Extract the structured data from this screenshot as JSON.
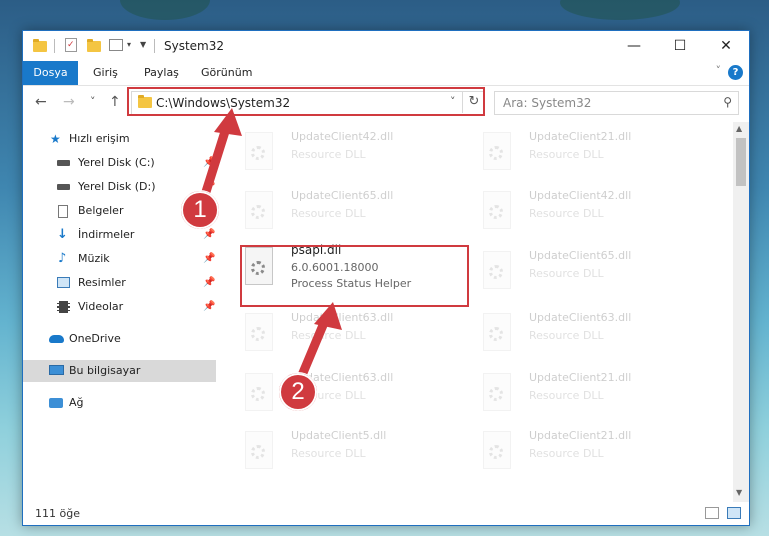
{
  "window": {
    "title": "System32",
    "controls": {
      "minimize": "—",
      "maximize": "☐",
      "close": "✕"
    }
  },
  "ribbon": {
    "tabs": [
      "Dosya",
      "Giriş",
      "Paylaş",
      "Görünüm"
    ],
    "help": "?"
  },
  "nav": {
    "back": "←",
    "forward": "→",
    "recent": "˅",
    "up": "↑",
    "address": "C:\\Windows\\System32",
    "search_placeholder": "Ara: System32"
  },
  "sidebar": {
    "items": [
      {
        "label": "Hızlı erişim",
        "icon": "star-icon",
        "pinned": false
      },
      {
        "label": "Yerel Disk (C:)",
        "icon": "drive-icon",
        "pinned": true
      },
      {
        "label": "Yerel Disk (D:)",
        "icon": "drive-icon",
        "pinned": true
      },
      {
        "label": "Belgeler",
        "icon": "documents-icon",
        "pinned": true
      },
      {
        "label": "İndirmeler",
        "icon": "downloads-icon",
        "pinned": true
      },
      {
        "label": "Müzik",
        "icon": "music-icon",
        "pinned": true
      },
      {
        "label": "Resimler",
        "icon": "pictures-icon",
        "pinned": true
      },
      {
        "label": "Videolar",
        "icon": "videos-icon",
        "pinned": true
      },
      {
        "label": "OneDrive",
        "icon": "cloud-icon",
        "pinned": false
      },
      {
        "label": "Bu bilgisayar",
        "icon": "computer-icon",
        "pinned": false,
        "selected": true
      },
      {
        "label": "Ağ",
        "icon": "network-icon",
        "pinned": false
      }
    ]
  },
  "files": {
    "left": [
      {
        "name": "UpdateClient42.dll",
        "desc": "Resource DLL"
      },
      {
        "name": "UpdateClient65.dll",
        "desc": "Resource DLL"
      },
      {
        "name": "psapi.dll",
        "version": "6.0.6001.18000",
        "desc": "Process Status Helper",
        "highlight": true
      },
      {
        "name": "UpdateClient63.dll",
        "desc": "Resource DLL"
      },
      {
        "name": "UpdateClient63.dll",
        "desc": "Resource DLL"
      },
      {
        "name": "UpdateClient5.dll",
        "desc": "Resource DLL"
      }
    ],
    "right": [
      {
        "name": "UpdateClient21.dll",
        "desc": "Resource DLL"
      },
      {
        "name": "UpdateClient42.dll",
        "desc": "Resource DLL"
      },
      {
        "name": "UpdateClient65.dll",
        "desc": "Resource DLL"
      },
      {
        "name": "UpdateClient63.dll",
        "desc": "Resource DLL"
      },
      {
        "name": "UpdateClient21.dll",
        "desc": "Resource DLL"
      },
      {
        "name": "UpdateClient21.dll",
        "desc": "Resource DLL"
      }
    ]
  },
  "status": {
    "count": "111 öğe"
  },
  "callouts": {
    "one": "1",
    "two": "2"
  },
  "colors": {
    "accent": "#1979ca",
    "callout": "#d03a3f",
    "selected": "#d9d9d9"
  }
}
